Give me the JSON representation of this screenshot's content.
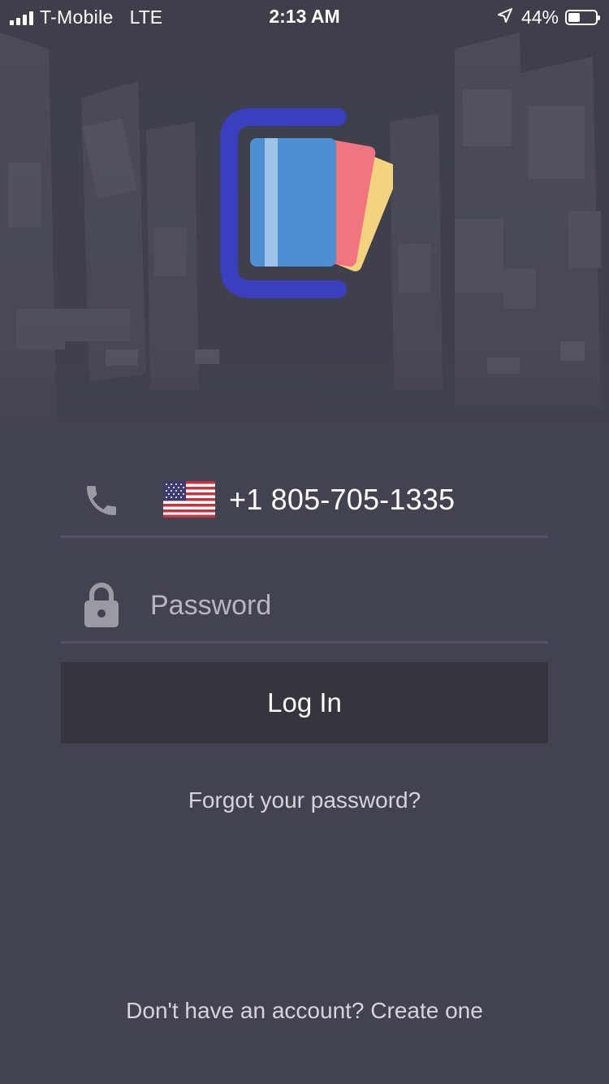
{
  "status_bar": {
    "carrier": "T-Mobile",
    "network": "LTE",
    "time": "2:13 AM",
    "battery_percent": "44%",
    "battery_level": 0.44,
    "icons": [
      "signal-bars-icon",
      "location-arrow-icon",
      "battery-icon"
    ]
  },
  "brand": {
    "logo_icon": "cards-wallet-logo",
    "colors": {
      "bracket": "#3a3fc0",
      "card_blue": "#4e8fd4",
      "card_stripe": "#9cc3ea",
      "card_red": "#ef7580",
      "card_yellow": "#f4d37e"
    }
  },
  "login_form": {
    "phone": {
      "icon": "phone-icon",
      "country_flag": "us-flag-icon",
      "value": "+1 805-705-1335"
    },
    "password": {
      "icon": "lock-icon",
      "placeholder": "Password",
      "value": ""
    },
    "submit_label": "Log In",
    "forgot_password_label": "Forgot your password?"
  },
  "signup": {
    "prompt": "Don't have an account?",
    "link_label": "Create one"
  },
  "theme": {
    "background": "#424350",
    "button_background": "#35353d",
    "underline": "#55506a"
  }
}
